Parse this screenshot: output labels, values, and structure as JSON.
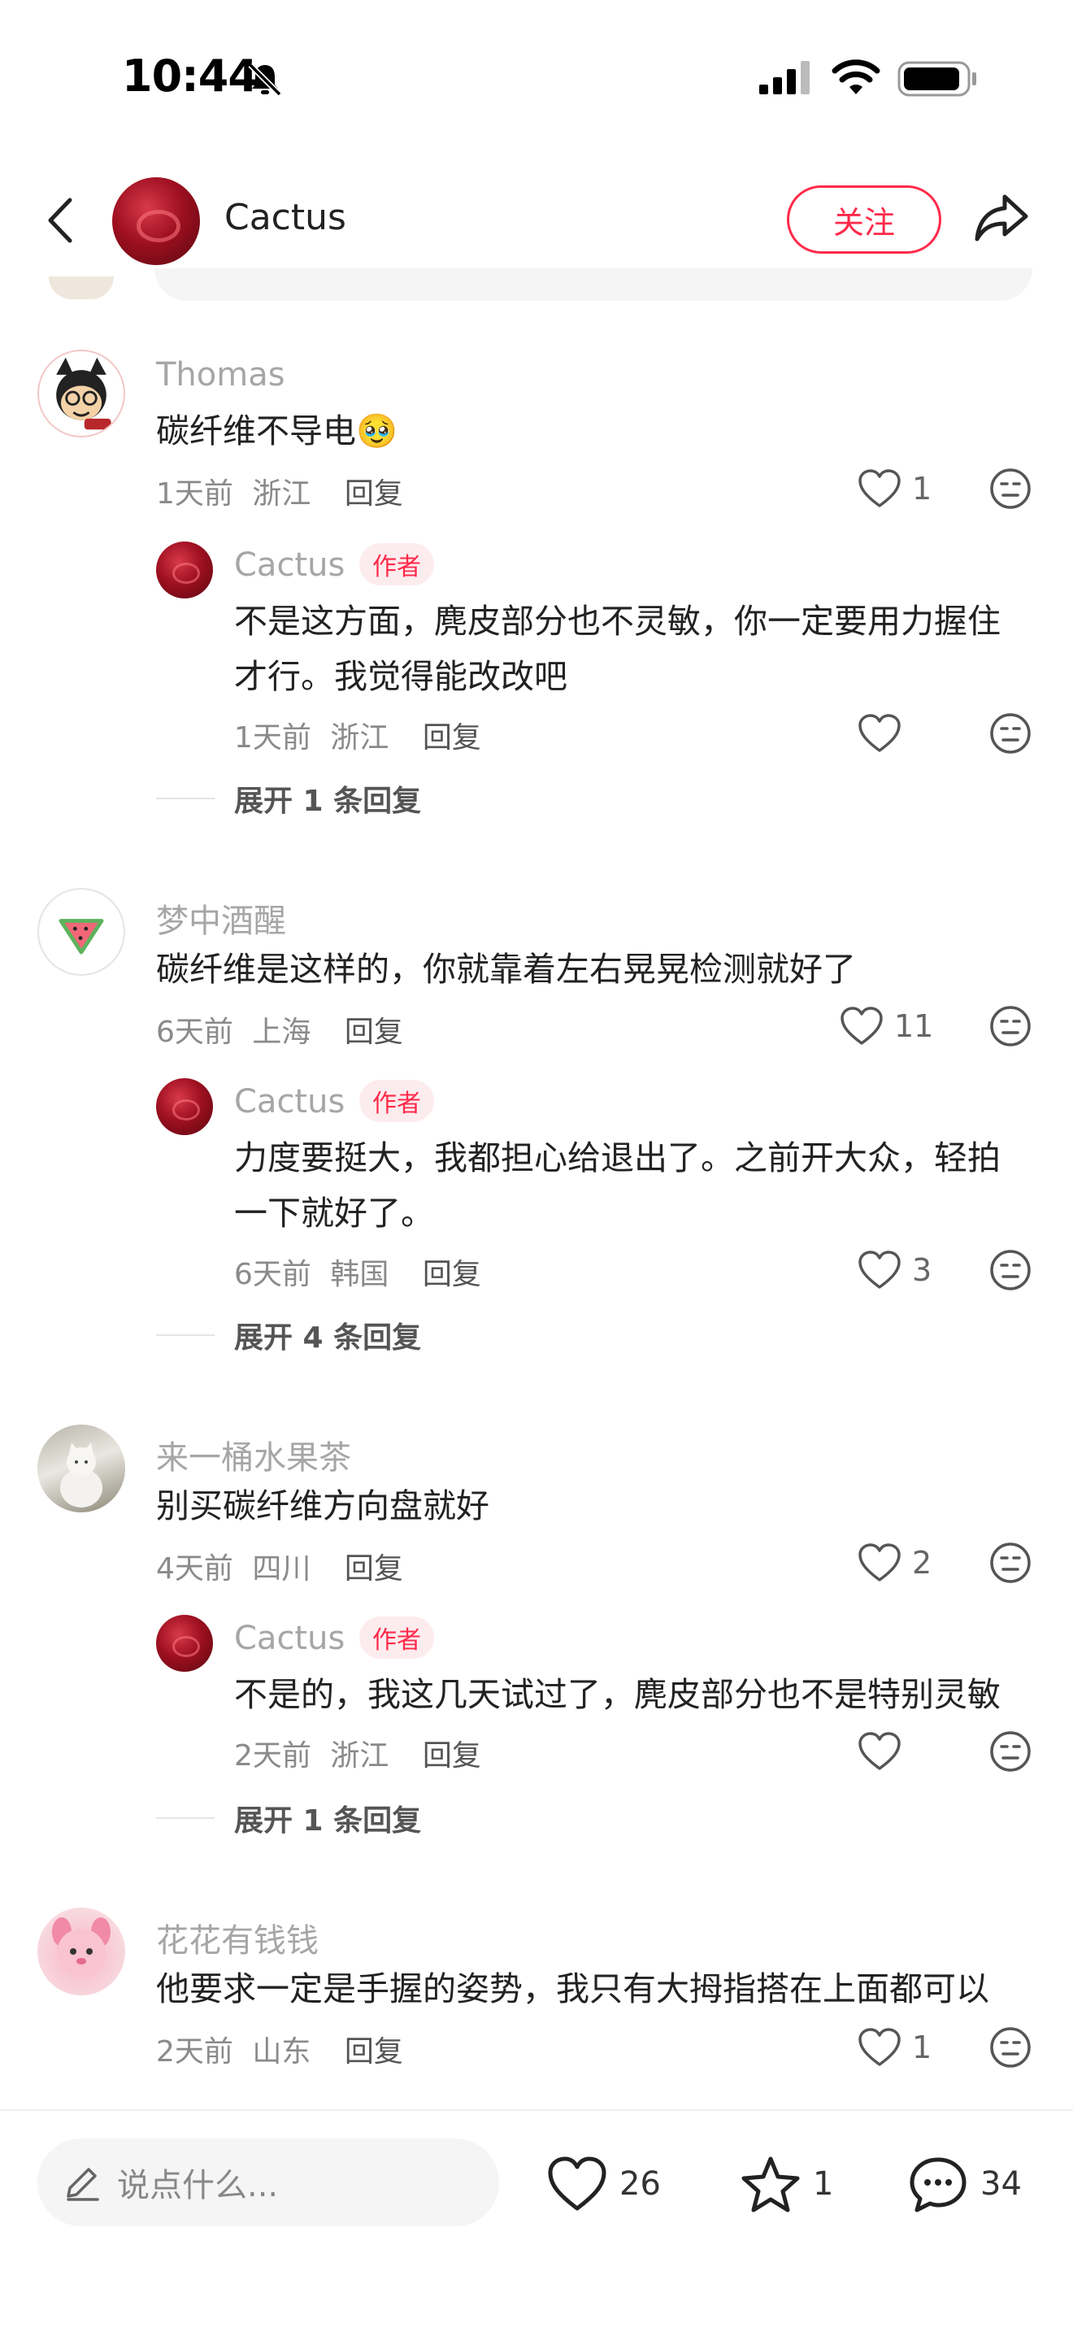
{
  "status_bar": {
    "time": "10:44"
  },
  "header": {
    "name": "Cactus",
    "follow_label": "关注"
  },
  "comments": [
    {
      "author": "Thomas",
      "text": "碳纤维不导电🥹",
      "time": "1天前",
      "location": "浙江",
      "reply_label": "回复",
      "likes": "1",
      "reply": {
        "author": "Cactus",
        "tag": "作者",
        "text": "不是这方面，麂皮部分也不灵敏，你一定要用力握住才行。我觉得能改改吧",
        "time": "1天前",
        "location": "浙江",
        "reply_label": "回复",
        "likes": ""
      },
      "expand": "展开 1 条回复"
    },
    {
      "author": "梦中酒醒",
      "text": "碳纤维是这样的，你就靠着左右晃晃检测就好了",
      "time": "6天前",
      "location": "上海",
      "reply_label": "回复",
      "likes": "11",
      "reply": {
        "author": "Cactus",
        "tag": "作者",
        "text": "力度要挺大，我都担心给退出了。之前开大众，轻拍一下就好了。",
        "time": "6天前",
        "location": "韩国",
        "reply_label": "回复",
        "likes": "3"
      },
      "expand": "展开 4 条回复"
    },
    {
      "author": "来一桶水果茶",
      "text": "别买碳纤维方向盘就好",
      "time": "4天前",
      "location": "四川",
      "reply_label": "回复",
      "likes": "2",
      "reply": {
        "author": "Cactus",
        "tag": "作者",
        "text": "不是的，我这几天试过了，麂皮部分也不是特别灵敏",
        "time": "2天前",
        "location": "浙江",
        "reply_label": "回复",
        "likes": ""
      },
      "expand": "展开 1 条回复"
    },
    {
      "author": "花花有钱钱",
      "text": "他要求一定是手握的姿势，我只有大拇指搭在上面都可以",
      "time": "2天前",
      "location": "山东",
      "reply_label": "回复",
      "likes": "1"
    }
  ],
  "bottom_bar": {
    "placeholder": "说点什么...",
    "likes": "26",
    "favorites": "1",
    "comments": "34"
  },
  "colors": {
    "accent": "#ff2a4a",
    "muted": "#a6a6a6"
  },
  "icons": [
    "back-icon",
    "share-icon",
    "heart-icon",
    "neutral-face-icon",
    "pen-icon",
    "star-icon",
    "chat-bubble-icon",
    "bell-off-icon",
    "signal-icon",
    "wifi-icon",
    "battery-icon"
  ]
}
